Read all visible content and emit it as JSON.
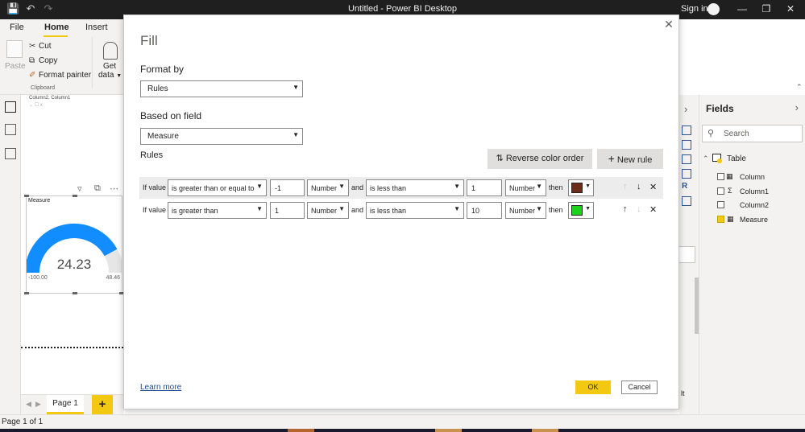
{
  "window": {
    "title": "Untitled - Power BI Desktop",
    "sign_in": "Sign in"
  },
  "ribbon": {
    "tabs": [
      "File",
      "Home",
      "Insert"
    ],
    "paste": "Paste",
    "cut": "Cut",
    "copy": "Copy",
    "format_painter": "Format painter",
    "get_data_line1": "Get",
    "get_data_line2": "data",
    "clipboard_group": "Clipboard"
  },
  "canvas": {
    "field_label": "Column2, Column1",
    "visual_title": "Measure",
    "gauge_value": "24.23",
    "gauge_min": "-100.00",
    "gauge_max": "48.46",
    "gauge_fraction": 0.84,
    "gauge_color": "#118dff"
  },
  "pages": {
    "tab": "Page 1",
    "add": "+",
    "status": "Page 1 of 1"
  },
  "fields_pane": {
    "title": "Fields",
    "search_placeholder": "Search",
    "table_name": "Table",
    "items": [
      {
        "label": "Column",
        "checked": false,
        "icon": "table-column-icon"
      },
      {
        "label": "Column1",
        "checked": false,
        "icon": "sigma-icon"
      },
      {
        "label": "Column2",
        "checked": false,
        "icon": ""
      },
      {
        "label": "Measure",
        "checked": true,
        "icon": "calculator-icon"
      }
    ],
    "partial_text": "lt"
  },
  "dialog": {
    "title": "Fill",
    "format_by_label": "Format by",
    "format_by_value": "Rules",
    "based_on_label": "Based on field",
    "based_on_value": "Measure",
    "rules_label": "Rules",
    "reverse_btn": "Reverse color order",
    "new_rule_btn": "New rule",
    "rules": [
      {
        "if_value": "If value",
        "op1": "is greater than or equal to",
        "val1": "-1",
        "type1": "Number",
        "and": "and",
        "op2": "is less than",
        "val2": "1",
        "type2": "Number",
        "then": "then",
        "color": "#6b2d1a"
      },
      {
        "if_value": "If value",
        "op1": "is greater than",
        "val1": "1",
        "type1": "Number",
        "and": "and",
        "op2": "is less than",
        "val2": "10",
        "type2": "Number",
        "then": "then",
        "color": "#1cd21c"
      }
    ],
    "learn_more": "Learn more",
    "ok": "OK",
    "cancel": "Cancel"
  }
}
